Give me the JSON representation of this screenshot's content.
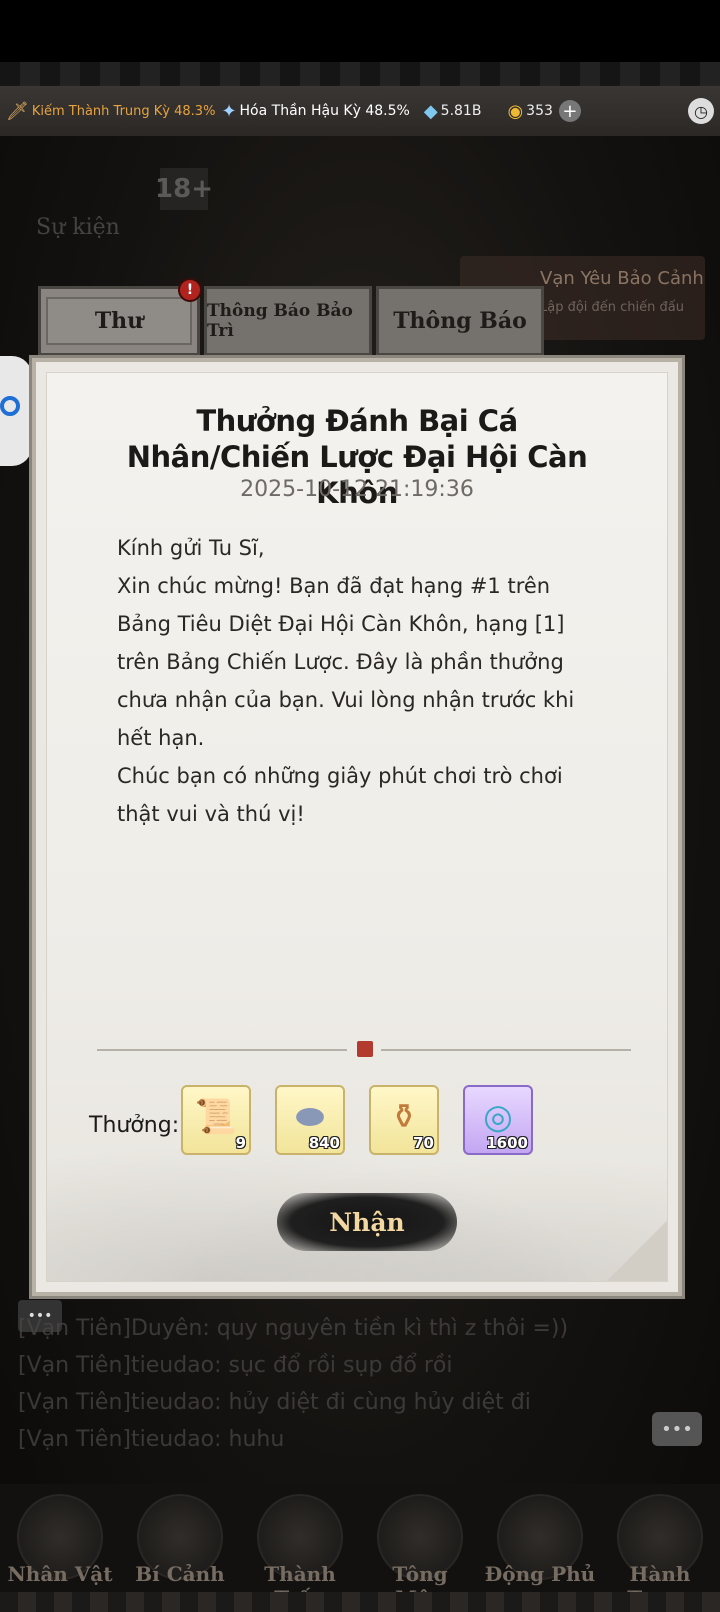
{
  "statusbar": {
    "rank1": "Kiếm Thành Trung Kỳ 48.3%",
    "rank2": "Hóa Thần Hậu Kỳ 48.5%",
    "crystals": "5.81B",
    "coins": "353",
    "plus": "+",
    "clock_icon": "clock-icon"
  },
  "background": {
    "age_rating": "18+",
    "events_label": "Sự kiện",
    "banner_title": "Vạn Yêu Bảo Cảnh",
    "banner_sub": "Lập đội đến chiến đấu"
  },
  "tabs": [
    {
      "label": "Thư"
    },
    {
      "label": "Thông Báo Bảo Trì"
    },
    {
      "label": "Thông Báo"
    }
  ],
  "tab_badge": "!",
  "mail": {
    "title": "Thưởng Đánh Bại Cá Nhân/Chiến Lược Đại Hội Càn Khôn",
    "date": "2025-10-12 21:19:36",
    "body": [
      "Kính gửi Tu Sĩ,",
      "Xin chúc mừng! Bạn đã đạt hạng #1 trên Bảng Tiêu Diệt Đại Hội Càn Khôn, hạng [1] trên Bảng Chiến Lược. Đây là phần thưởng chưa nhận của bạn. Vui lòng nhận trước khi hết hạn.",
      "Chúc bạn có những giây phút chơi trò chơi thật vui và thú vị!"
    ],
    "reward_label": "Thưởng:",
    "rewards": [
      {
        "icon": "scroll-map-icon",
        "qty": "9"
      },
      {
        "icon": "silver-ingot-icon",
        "qty": "840"
      },
      {
        "icon": "pill-bottle-icon",
        "qty": "70"
      },
      {
        "icon": "jade-disc-icon",
        "qty": "1600"
      }
    ],
    "claim_label": "Nhận"
  },
  "chat": [
    "[Vạn Tiên]Duyên:  quy nguyên tiền kì thì z thôi =))",
    "[Vạn Tiên]tieudao:  sục đổ rồi sụp đổ rồi",
    "[Vạn Tiên]tieudao:  hủy diệt đi cùng hủy diệt đi",
    "[Vạn Tiên]tieudao:  huhu"
  ],
  "nav": [
    {
      "label": "Nhân Vật"
    },
    {
      "label": "Bí Cảnh"
    },
    {
      "label": "Thành Trấn"
    },
    {
      "label": "Tông Môn"
    },
    {
      "label": "Động Phủ"
    },
    {
      "label": "Hành Trang"
    }
  ]
}
